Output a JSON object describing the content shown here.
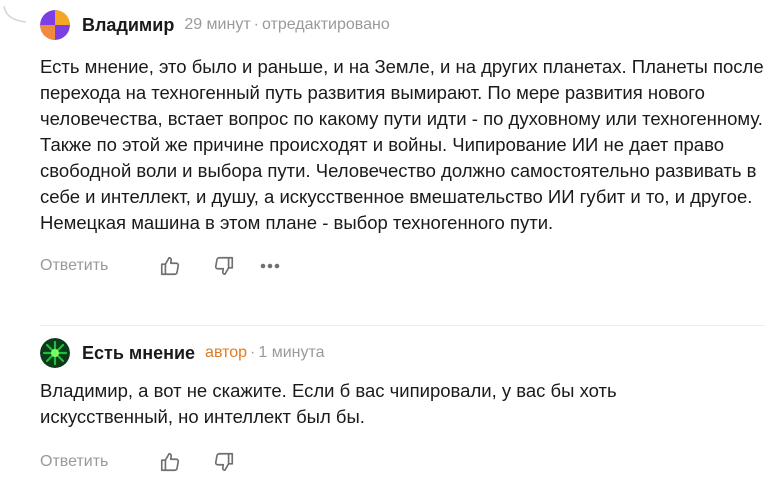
{
  "comments": [
    {
      "author": "Владимир",
      "time": "29 минут",
      "edited": "отредактировано",
      "text": "Есть мнение, это было и раньше, и на Земле, и на других планетах. Планеты после перехода на техногенный путь развития вымирают. По мере развития нового человечества, встает вопрос по какому пути идти - по духовному или техногенному. Также по этой же причине происходят и войны. Чипирование ИИ не дает право свободной воли и выбора пути. Человечество должно самостоятельно развивать в себе и интеллект, и душу, а искусственное вмешательство ИИ губит и то, и другое. Немецкая машина в этом плане - выбор техногенного пути.",
      "reply_label": "Ответить",
      "icons": [
        "like-icon",
        "dislike-icon",
        "more-icon"
      ]
    },
    {
      "author": "Есть мнение",
      "badge": "автор",
      "time": "1 минута",
      "text": "Владимир, а вот не скажите. Если б вас чипировали, у вас бы хоть искусственный, но интеллект был бы.",
      "reply_label": "Ответить",
      "icons": [
        "like-icon",
        "dislike-icon"
      ]
    }
  ],
  "colors": {
    "author_badge": "#e07a22",
    "meta_gray": "#9a9a9a",
    "avatar1_orange": "#f5a623",
    "avatar1_purple": "#7b3fe4",
    "avatar2_green": "#1fbf3a"
  },
  "separator": "·"
}
